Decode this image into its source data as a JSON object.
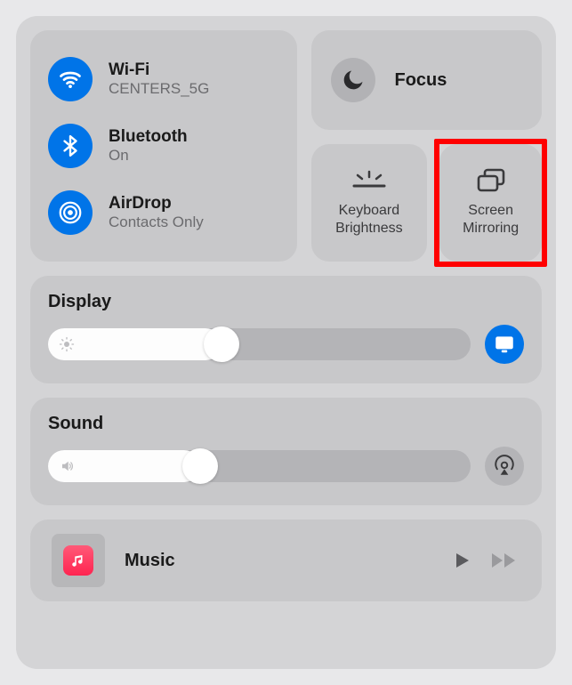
{
  "connectivity": {
    "wifi": {
      "title": "Wi-Fi",
      "sub": "CENTERS_5G"
    },
    "bluetooth": {
      "title": "Bluetooth",
      "sub": "On"
    },
    "airdrop": {
      "title": "AirDrop",
      "sub": "Contacts Only"
    }
  },
  "focus": {
    "label": "Focus"
  },
  "keyboard_brightness": {
    "label": "Keyboard\nBrightness"
  },
  "screen_mirroring": {
    "label": "Screen\nMirroring"
  },
  "display": {
    "title": "Display",
    "level": 37
  },
  "sound": {
    "title": "Sound",
    "level": 32
  },
  "music": {
    "label": "Music"
  }
}
